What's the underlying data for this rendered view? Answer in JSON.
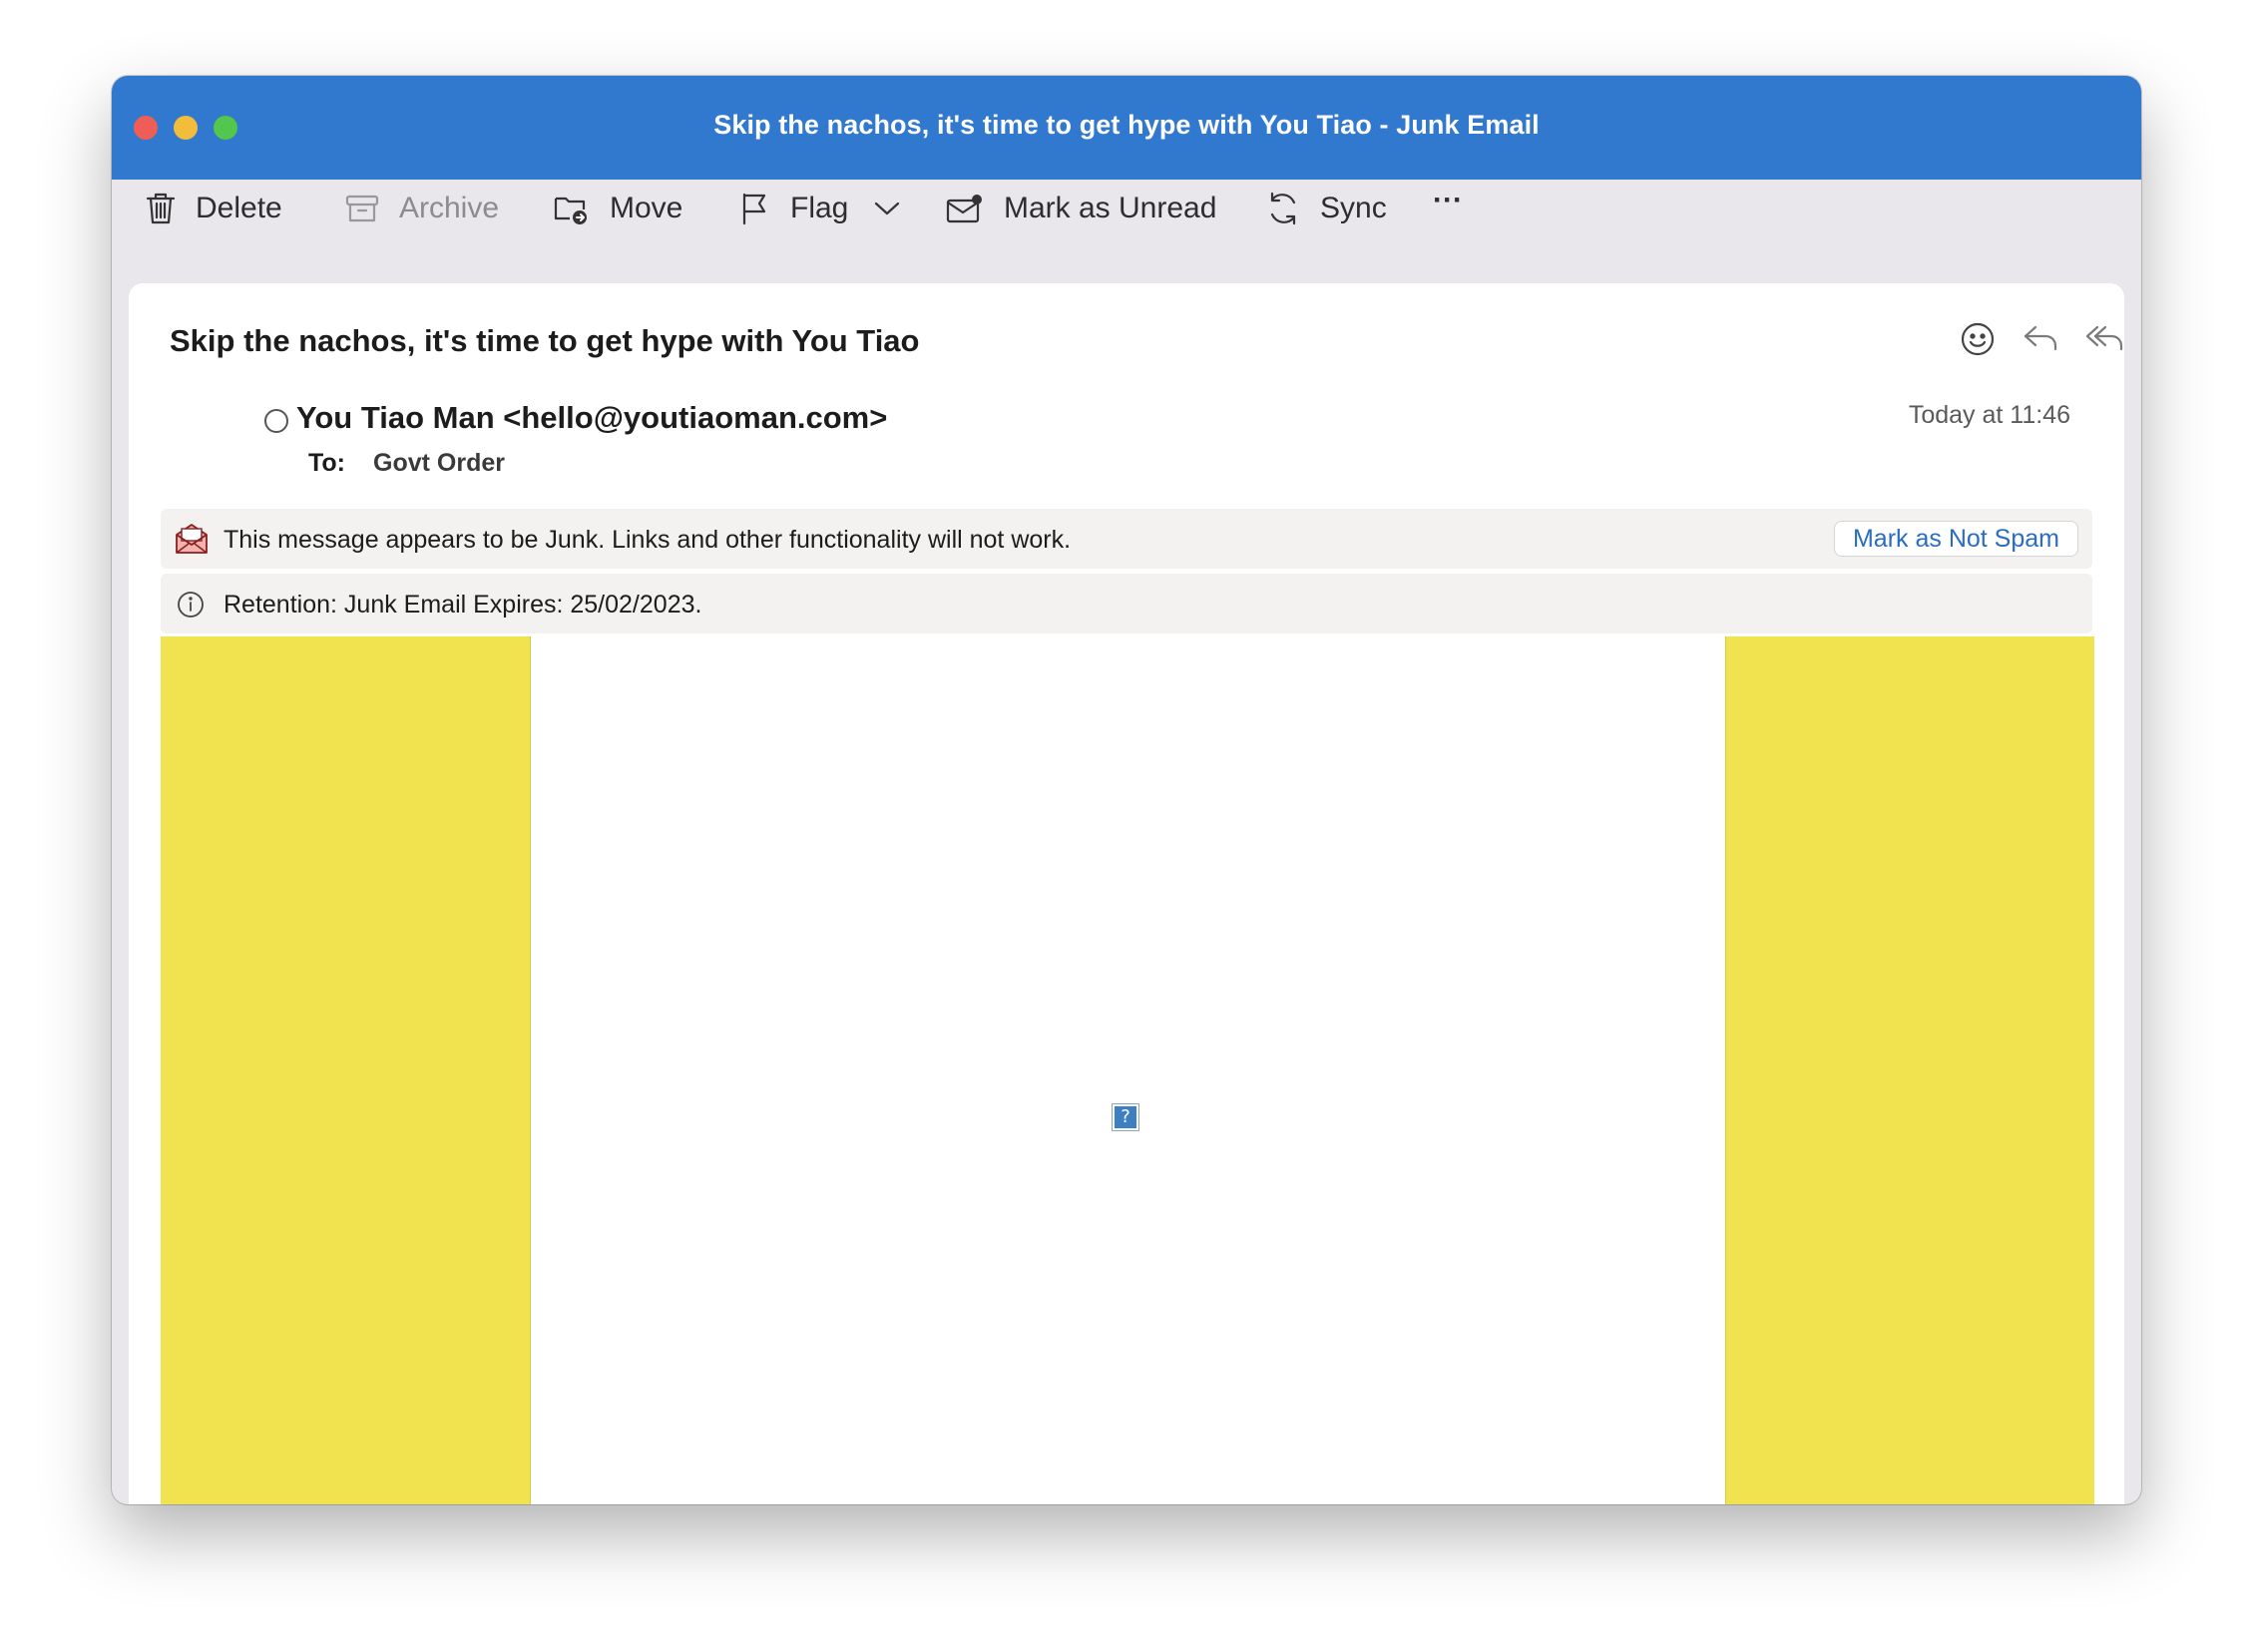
{
  "window": {
    "title": "Skip the nachos, it's time to get hype with You Tiao - Junk Email",
    "titlebar_color": "#3178cf"
  },
  "toolbar": {
    "delete_label": "Delete",
    "archive_label": "Archive",
    "move_label": "Move",
    "flag_label": "Flag",
    "mark_unread_label": "Mark as Unread",
    "sync_label": "Sync",
    "more_label": "···"
  },
  "message": {
    "subject": "Skip the nachos, it's time to get hype with You Tiao",
    "sender": "You Tiao Man <hello@youtiaoman.com>",
    "timestamp": "Today at 11:46",
    "to_label": "To:",
    "to_value": "Govt Order"
  },
  "banners": {
    "junk_text": "This message appears to be Junk. Links and other functionality will not work.",
    "not_spam_button": "Mark as Not Spam",
    "retention_text": "Retention: Junk Email Expires: 25/02/2023."
  },
  "email_body": {
    "side_color": "#f1e350",
    "broken_image_glyph": "?"
  }
}
